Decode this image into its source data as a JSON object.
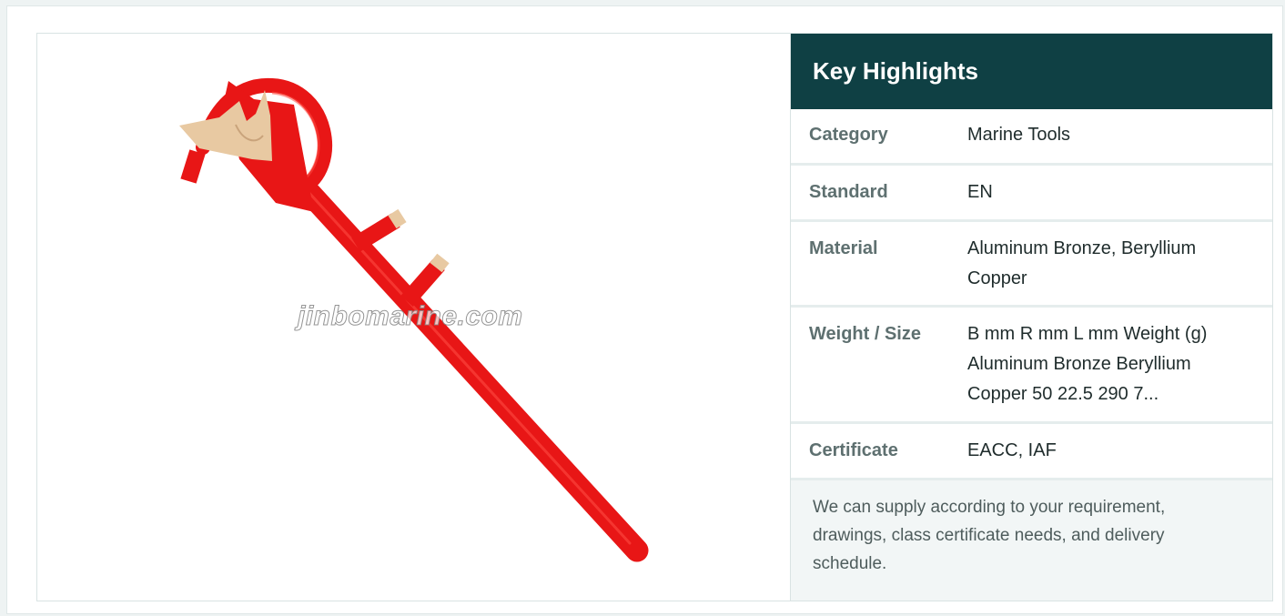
{
  "image": {
    "alt": "Marine hand tool with red handle and bronze tips",
    "watermark": "jinbomarine.com"
  },
  "highlights": {
    "title": "Key Highlights",
    "rows": [
      {
        "label": "Category",
        "value": "Marine Tools"
      },
      {
        "label": "Standard",
        "value": "EN"
      },
      {
        "label": "Material",
        "value": "Aluminum Bronze, Beryllium Copper"
      },
      {
        "label": "Weight / Size",
        "value": "B mm R mm L mm Weight (g) Aluminum Bronze Beryllium Copper 50 22.5 290 7..."
      },
      {
        "label": "Certificate",
        "value": "EACC, IAF"
      }
    ],
    "note": "We can supply according to your requirement, drawings, class certificate needs, and delivery schedule."
  },
  "colors": {
    "header_bg": "#0f4044",
    "tool_red": "#e81616",
    "tip_beige": "#e8c9a2",
    "note_bg": "#f2f6f6"
  }
}
